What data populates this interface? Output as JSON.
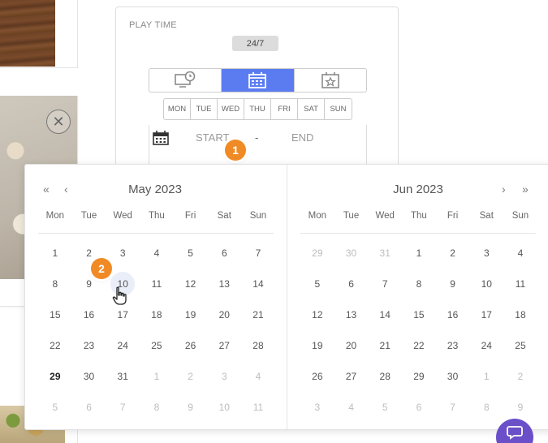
{
  "play_time": {
    "title": "PLAY TIME",
    "badge": "24/7",
    "mode_tabs": [
      {
        "icon": "monitor-clock-icon",
        "active": false
      },
      {
        "icon": "calendar-icon",
        "active": true
      },
      {
        "icon": "calendar-star-icon",
        "active": false
      }
    ],
    "days": [
      "MON",
      "TUE",
      "WED",
      "THU",
      "FRI",
      "SAT",
      "SUN"
    ],
    "date_range": {
      "start_placeholder": "START",
      "separator": "-",
      "end_placeholder": "END"
    }
  },
  "steps": {
    "one": "1",
    "two": "2"
  },
  "calendar": {
    "nav": {
      "prev_year": "«",
      "prev_month": "‹",
      "next_month": "›",
      "next_year": "»"
    },
    "weekdays": [
      "Mon",
      "Tue",
      "Wed",
      "Thu",
      "Fri",
      "Sat",
      "Sun"
    ],
    "months": [
      {
        "title": "May 2023",
        "weeks": [
          [
            "1",
            "2",
            "3",
            "4",
            "5",
            "6",
            "7"
          ],
          [
            "8",
            "9",
            "10",
            "11",
            "12",
            "13",
            "14"
          ],
          [
            "15",
            "16",
            "17",
            "18",
            "19",
            "20",
            "21"
          ],
          [
            "22",
            "23",
            "24",
            "25",
            "26",
            "27",
            "28"
          ],
          [
            "29",
            "30",
            "31",
            "1",
            "2",
            "3",
            "4"
          ],
          [
            "5",
            "6",
            "7",
            "8",
            "9",
            "10",
            "11"
          ]
        ]
      },
      {
        "title": "Jun 2023",
        "weeks": [
          [
            "29",
            "30",
            "31",
            "1",
            "2",
            "3",
            "4"
          ],
          [
            "5",
            "6",
            "7",
            "8",
            "9",
            "10",
            "11"
          ],
          [
            "12",
            "13",
            "14",
            "15",
            "16",
            "17",
            "18"
          ],
          [
            "19",
            "20",
            "21",
            "22",
            "23",
            "24",
            "25"
          ],
          [
            "26",
            "27",
            "28",
            "29",
            "30",
            "1",
            "2"
          ],
          [
            "3",
            "4",
            "5",
            "6",
            "7",
            "8",
            "9"
          ]
        ]
      }
    ]
  },
  "colors": {
    "accent": "#5b7cf0",
    "step_badge": "#f08a24",
    "chat": "#6a4fc9"
  }
}
